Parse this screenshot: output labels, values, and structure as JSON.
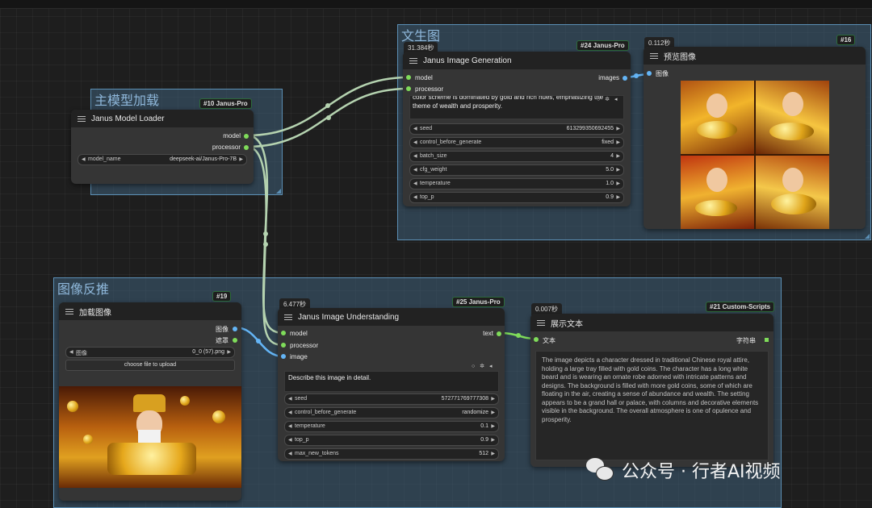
{
  "groups": {
    "text_to_image": {
      "title": "文生图"
    },
    "model_load": {
      "title": "主模型加载"
    },
    "image_reverse": {
      "title": "图像反推"
    }
  },
  "nodes": {
    "model_loader": {
      "title": "Janus Model Loader",
      "tag": "#10 Janus-Pro",
      "outputs": [
        "model",
        "processor"
      ],
      "widget": {
        "label": "model_name",
        "value": "deepseek-ai/Janus-Pro-7B"
      }
    },
    "generation": {
      "title": "Janus Image Generation",
      "tag": "#24 Janus-Pro",
      "time": "31.384秒",
      "inputs": [
        "model",
        "processor"
      ],
      "output": "images",
      "prompt_tail": "color scheme is dominated by gold and rich hues, emphasizing the theme of wealth and prosperity.",
      "widgets": [
        {
          "label": "seed",
          "value": "613299350692455"
        },
        {
          "label": "control_before_generate",
          "value": "fixed"
        },
        {
          "label": "batch_size",
          "value": "4"
        },
        {
          "label": "cfg_weight",
          "value": "5.0"
        },
        {
          "label": "temperature",
          "value": "1.0"
        },
        {
          "label": "top_p",
          "value": "0.9"
        }
      ]
    },
    "preview": {
      "title": "预览图像",
      "tag": "#16",
      "time": "0.112秒",
      "input": "图像"
    },
    "load_image": {
      "title": "加载图像",
      "tag": "#19",
      "outputs": [
        "图像",
        "遮罩"
      ],
      "widget": {
        "label": "图像",
        "value": "0_0 (57).png"
      },
      "upload_label": "choose file to upload"
    },
    "understanding": {
      "title": "Janus Image Understanding",
      "tag": "#25 Janus-Pro",
      "time": "6.477秒",
      "inputs": [
        "model",
        "processor",
        "image"
      ],
      "output": "text",
      "question": "Describe this image in detail.",
      "widgets": [
        {
          "label": "seed",
          "value": "572771769777308"
        },
        {
          "label": "control_before_generate",
          "value": "randomize"
        },
        {
          "label": "temperature",
          "value": "0.1"
        },
        {
          "label": "top_p",
          "value": "0.9"
        },
        {
          "label": "max_new_tokens",
          "value": "512"
        }
      ]
    },
    "show_text": {
      "title": "展示文本",
      "tag": "#21 Custom-Scripts",
      "time": "0.007秒",
      "input": "文本",
      "output": "字符串",
      "text": "The image depicts a character dressed in traditional Chinese royal attire, holding a large tray filled with gold coins. The character has a long white beard and is wearing an ornate robe adorned with intricate patterns and designs. The background is filled with more gold coins, some of which are floating in the air, creating a sense of abundance and wealth. The setting appears to be a grand hall or palace, with columns and decorative elements visible in the background. The overall atmosphere is one of opulence and prosperity."
    }
  },
  "watermark": "公众号 · 行者AI视频",
  "colors": {
    "group_fill": "#3e5f78",
    "group_border": "#5b8fb5",
    "node_bg": "#353535",
    "port_green": "#7fdc5a",
    "port_blue": "#64b5f6"
  }
}
